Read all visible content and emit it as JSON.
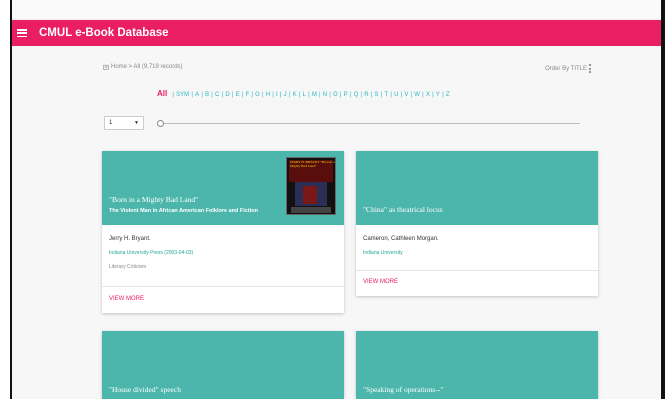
{
  "app": {
    "title": "CMUL e-Book Database"
  },
  "breadcrumb": {
    "text": "Home > All (9,719 records)"
  },
  "order": {
    "label": "Order By TITLE"
  },
  "alphabet": {
    "all": "All",
    "letters": [
      "SYM",
      "A",
      "B",
      "C",
      "D",
      "E",
      "F",
      "G",
      "H",
      "I",
      "J",
      "K",
      "L",
      "M",
      "N",
      "O",
      "P",
      "Q",
      "R",
      "S",
      "T",
      "U",
      "V",
      "W",
      "X",
      "Y",
      "Z"
    ]
  },
  "pagination": {
    "selected_page": "1"
  },
  "colors": {
    "primary": "#e91e63",
    "card_header": "#4db6ac",
    "link": "#29b6c6"
  },
  "cards": [
    {
      "title": "\"Born in a Mighty Bad Land\"",
      "subtitle": "The Violent Man in African American Folklore and Fiction",
      "author": "Jerry H. Bryant.",
      "publisher": "Indiana University Press (2003-04-03)",
      "category": "Literary Criticism",
      "action": "VIEW MORE",
      "cover_text": "JERRY H. BRYANT \"Born in a Mighty Bad Land\""
    },
    {
      "title": "\"China\" as theatrical locus",
      "author": "Cameron, Cathleen Morgan.",
      "publisher": "Indiana University",
      "action": "VIEW MORE"
    },
    {
      "title": "\"House divided\" speech"
    },
    {
      "title": "\"Speaking of operations--\""
    }
  ]
}
